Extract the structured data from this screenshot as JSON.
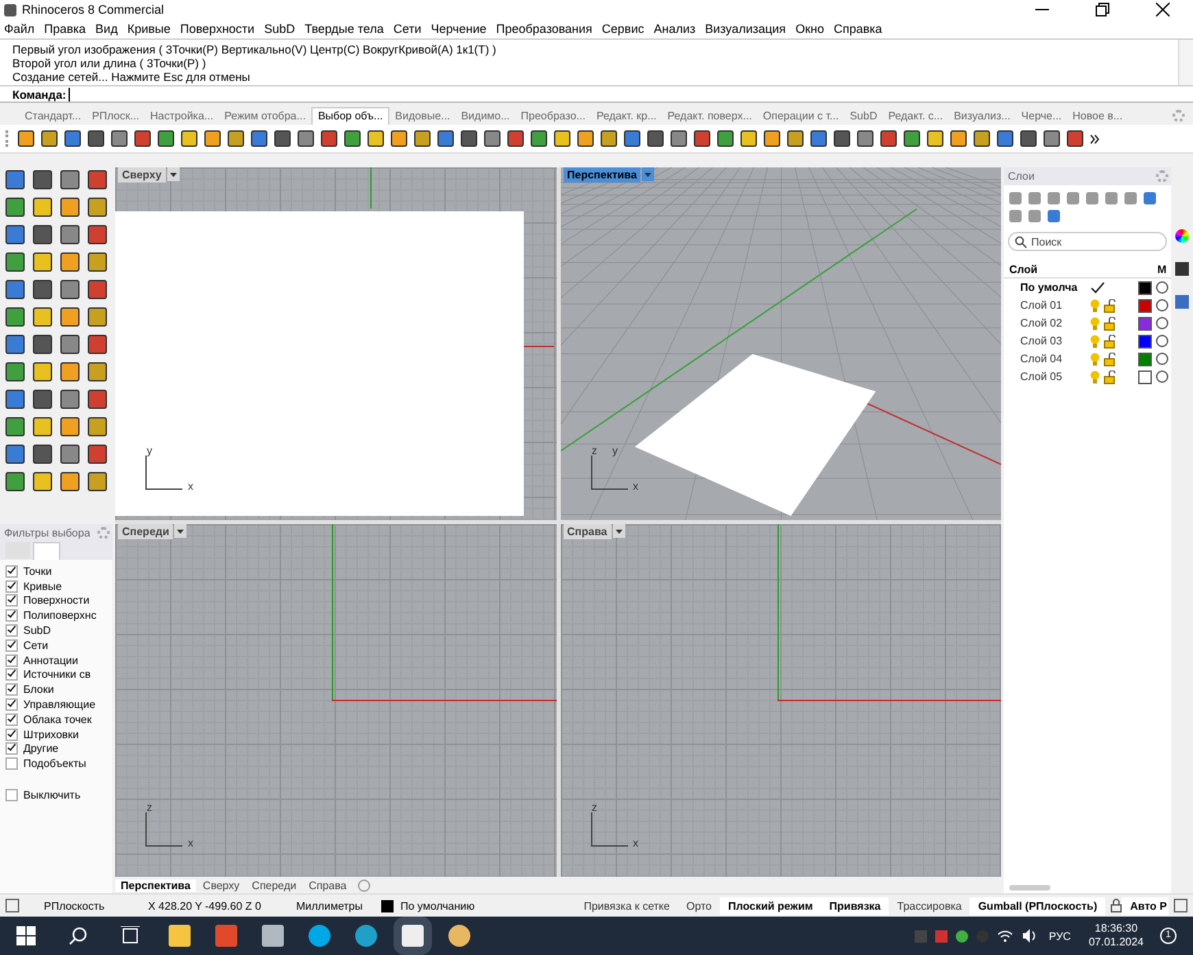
{
  "window": {
    "title": "Rhinoceros 8 Commercial"
  },
  "menu": [
    "Файл",
    "Правка",
    "Вид",
    "Кривые",
    "Поверхности",
    "SubD",
    "Твердые тела",
    "Сети",
    "Черчение",
    "Преобразования",
    "Сервис",
    "Анализ",
    "Визуализация",
    "Окно",
    "Справка"
  ],
  "command_history": [
    "Первый угол изображения ( 3Точки(P)  Вертикально(V)  Центр(C)  ВокругКривой(A)  1к1(T) )",
    "Второй угол или длина ( 3Точки(P) )",
    "Создание сетей... Нажмите Esc для отмены"
  ],
  "command_prompt": {
    "label": "Команда:"
  },
  "toolbar_tabs": [
    {
      "label": "Стандарт...",
      "selected": false
    },
    {
      "label": "РПлоск...",
      "selected": false
    },
    {
      "label": "Настройка...",
      "selected": false
    },
    {
      "label": "Режим отобра...",
      "selected": false
    },
    {
      "label": "Выбор объ...",
      "selected": true
    },
    {
      "label": "Видовые...",
      "selected": false
    },
    {
      "label": "Видимо...",
      "selected": false
    },
    {
      "label": "Преобразо...",
      "selected": false
    },
    {
      "label": "Редакт. кр...",
      "selected": false
    },
    {
      "label": "Редакт. поверх...",
      "selected": false
    },
    {
      "label": "Операции с т...",
      "selected": false
    },
    {
      "label": "SubD",
      "selected": false
    },
    {
      "label": "Редакт. с...",
      "selected": false
    },
    {
      "label": "Визуализ...",
      "selected": false
    },
    {
      "label": "Черче...",
      "selected": false
    },
    {
      "label": "Новое в...",
      "selected": false
    }
  ],
  "viewports": [
    {
      "title": "Сверху",
      "selected": false,
      "kind": "top",
      "axes": [
        "y",
        "x"
      ]
    },
    {
      "title": "Перспектива",
      "selected": true,
      "kind": "perspective",
      "axes": [
        "z",
        "y",
        "x"
      ]
    },
    {
      "title": "Спереди",
      "selected": false,
      "kind": "front",
      "axes": [
        "z",
        "x"
      ]
    },
    {
      "title": "Справа",
      "selected": false,
      "kind": "right",
      "axes": [
        "z",
        "x"
      ]
    }
  ],
  "viewport_tabs": [
    {
      "label": "Перспектива",
      "selected": true
    },
    {
      "label": "Сверху",
      "selected": false
    },
    {
      "label": "Спереди",
      "selected": false
    },
    {
      "label": "Справа",
      "selected": false
    }
  ],
  "selection_filters": {
    "title": "Фильтры выбора",
    "items": [
      {
        "label": "Точки",
        "checked": true
      },
      {
        "label": "Кривые",
        "checked": true
      },
      {
        "label": "Поверхности",
        "checked": true
      },
      {
        "label": "Полиповерхнс",
        "checked": true
      },
      {
        "label": "SubD",
        "checked": true
      },
      {
        "label": "Сети",
        "checked": true
      },
      {
        "label": "Аннотации",
        "checked": true
      },
      {
        "label": "Источники св",
        "checked": true
      },
      {
        "label": "Блоки",
        "checked": true
      },
      {
        "label": "Управляющие",
        "checked": true
      },
      {
        "label": "Облака точек",
        "checked": true
      },
      {
        "label": "Штриховки",
        "checked": true
      },
      {
        "label": "Другие",
        "checked": true
      },
      {
        "label": "Подобъекты",
        "checked": false
      }
    ],
    "disable": {
      "label": "Выключить",
      "checked": false
    }
  },
  "layers": {
    "title": "Слои",
    "search": {
      "placeholder": "Поиск"
    },
    "columns": [
      "Слой",
      "М"
    ],
    "rows": [
      {
        "name": "По умолча",
        "current": true,
        "color": "#000000"
      },
      {
        "name": "Слой 01",
        "current": false,
        "color": "#cc0000"
      },
      {
        "name": "Слой 02",
        "current": false,
        "color": "#8a2be2"
      },
      {
        "name": "Слой 03",
        "current": false,
        "color": "#0000ff"
      },
      {
        "name": "Слой 04",
        "current": false,
        "color": "#008000"
      },
      {
        "name": "Слой 05",
        "current": false,
        "color": "#ffffff"
      }
    ]
  },
  "status_bar": {
    "cplane": "РПлоскость",
    "coordinates": "X 428.20 Y -499.60 Z 0",
    "units": "Миллиметры",
    "layer": "По умолчанию",
    "toggles": [
      {
        "label": "Привязка к сетке",
        "on": false
      },
      {
        "label": "Орто",
        "on": false
      },
      {
        "label": "Плоский режим",
        "on": true
      },
      {
        "label": "Привязка",
        "on": true
      },
      {
        "label": "Трассировка",
        "on": false
      },
      {
        "label": "Gumball (РПлоскость)",
        "on": true
      }
    ],
    "auto": "Авто Р"
  },
  "taskbar": {
    "language": "РУС",
    "time": "18:36:30",
    "date": "07.01.2024",
    "notifications": "1"
  }
}
